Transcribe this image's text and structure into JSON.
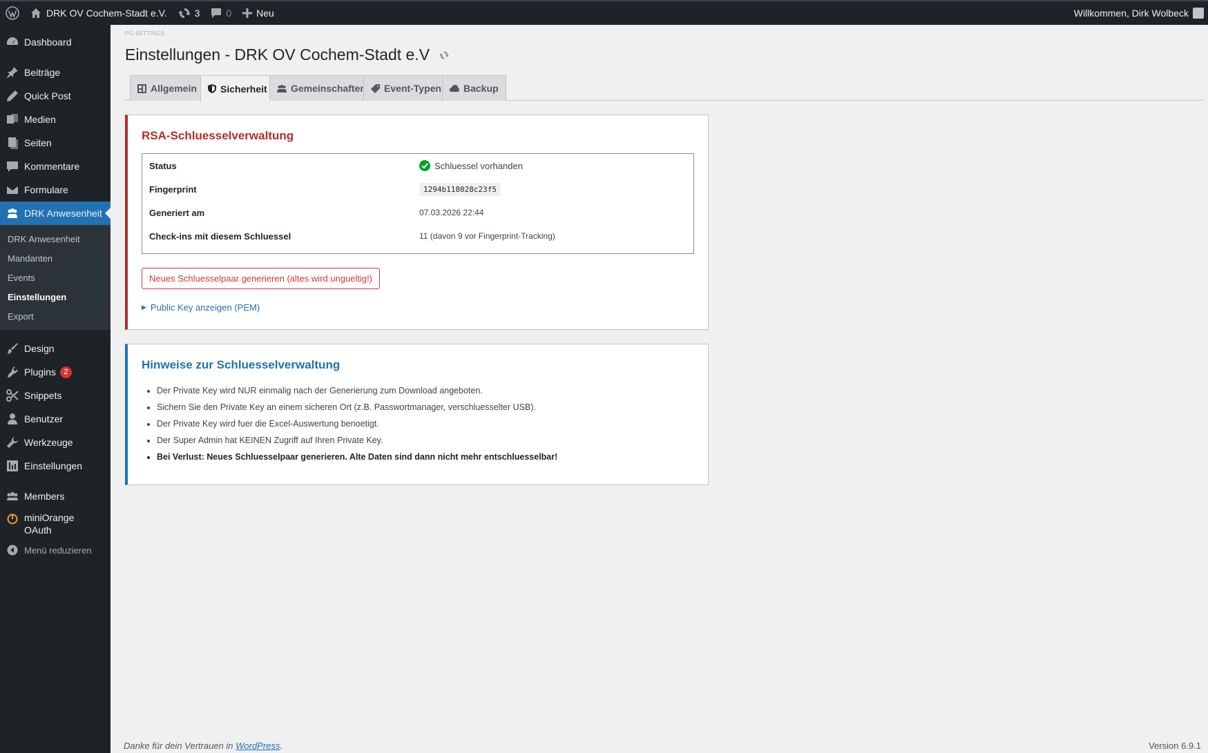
{
  "adminbar": {
    "site_name": "DRK OV Cochem-Stadt e.V.",
    "updates_count": "3",
    "comments_count": "0",
    "new_label": "Neu",
    "greeting": "Willkommen, Dirk Wolbeck"
  },
  "sidebar": {
    "dashboard": "Dashboard",
    "beitraege": "Beiträge",
    "quick_post": "Quick Post",
    "medien": "Medien",
    "seiten": "Seiten",
    "kommentare": "Kommentare",
    "formulare": "Formulare",
    "drk": "DRK Anwesenheit",
    "submenu": [
      "DRK Anwesenheit",
      "Mandanten",
      "Events",
      "Einstellungen",
      "Export"
    ],
    "design": "Design",
    "plugins": "Plugins",
    "plugins_badge": "2",
    "snippets": "Snippets",
    "benutzer": "Benutzer",
    "werkzeuge": "Werkzeuge",
    "einstellungen": "Einstellungen",
    "members": "Members",
    "miniorange": "miniOrange OAuth",
    "collapse": "Menü reduzieren"
  },
  "page": {
    "slug": "PG-SETTINGS",
    "title": "Einstellungen - DRK OV Cochem-Stadt e.V"
  },
  "tabs": [
    "Allgemein",
    "Sicherheit",
    "Gemeinschaften",
    "Event-Typen",
    "Backup"
  ],
  "rsa": {
    "heading": "RSA-Schluesselverwaltung",
    "rows": [
      {
        "label": "Status",
        "value": "Schluessel vorhanden"
      },
      {
        "label": "Fingerprint",
        "value": "1294b118028c23f5"
      },
      {
        "label": "Generiert am",
        "value": "07.03.2026 22:44"
      },
      {
        "label": "Check-ins mit diesem Schluessel",
        "value": "11 (davon 9 vor Fingerprint-Tracking)"
      }
    ],
    "regenerate_button": "Neues Schluesselpaar generieren (altes wird ungueltig!)",
    "pem_toggle": "Public Key anzeigen (PEM)"
  },
  "hints": {
    "heading": "Hinweise zur Schluesselverwaltung",
    "items": [
      "Der Private Key wird NUR einmalig nach der Generierung zum Download angeboten.",
      "Sichern Sie den Private Key an einem sicheren Ort (z.B. Passwortmanager, verschluesselter USB).",
      "Der Private Key wird fuer die Excel-Auswertung benoetigt.",
      "Der Super Admin hat KEINEN Zugriff auf Ihren Private Key.",
      "Bei Verlust: Neues Schluesselpaar generieren. Alte Daten sind dann nicht mehr entschluesselbar!"
    ]
  },
  "footer": {
    "thanks_prefix": "Danke für dein Vertrauen in ",
    "wordpress_link": "WordPress",
    "thanks_suffix": ".",
    "version": "Version 6.9.1"
  },
  "colors": {
    "accent": "#2271b1",
    "danger": "#b32d2e",
    "success": "#00a32a"
  }
}
